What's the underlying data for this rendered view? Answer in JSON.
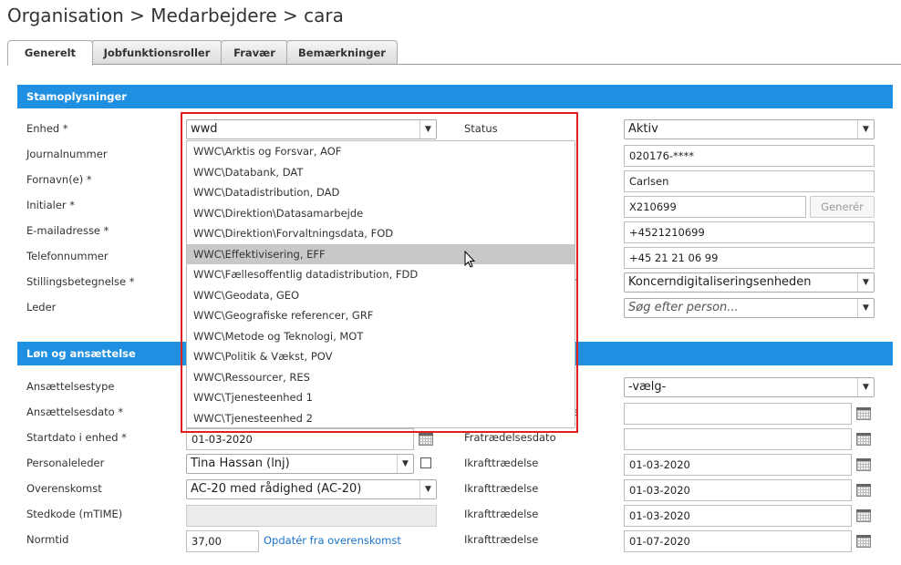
{
  "breadcrumb": {
    "part1": "Organisation",
    "sep1": ">",
    "part2": "Medarbejdere",
    "sep2": ">",
    "part3": "cara"
  },
  "tabs": [
    "Generelt",
    "Jobfunktionsroller",
    "Fravær",
    "Bemærkninger"
  ],
  "sections": {
    "stam": "Stamoplysninger",
    "loen": "Løn og ansættelse"
  },
  "left_labels": [
    "Enhed *",
    "Journalnummer",
    "Fornavn(e) *",
    "Initialer *",
    "E-mailadresse *",
    "Telefonnummer",
    "Stillingsbetegnelse *",
    "Leder"
  ],
  "enhed_input": "wwd",
  "dropdown_items": [
    "WWC\\Arktis og Forsvar, AOF",
    "WWC\\Databank, DAT",
    "WWC\\Datadistribution, DAD",
    "WWC\\Direktion\\Datasamarbejde",
    "WWC\\Direktion\\Forvaltningsdata, FOD",
    "WWC\\Effektivisering, EFF",
    "WWC\\Fællesoffentlig datadistribution, FDD",
    "WWC\\Geodata, GEO",
    "WWC\\Geografiske referencer, GRF",
    "WWC\\Metode og Teknologi, MOT",
    "WWC\\Politik & Vækst, POV",
    "WWC\\Ressourcer, RES",
    "WWC\\Tjenesteenhed 1",
    "WWC\\Tjenesteenhed 2"
  ],
  "highlighted_index": 5,
  "status_label": "Status",
  "status_value": "Aktiv",
  "right": {
    "journal": "020176-****",
    "efternavn": "Carlsen",
    "initialer": "X210699",
    "generer": "Generér",
    "email": "+4521210699",
    "telefon": "+45 21 21 06 99",
    "enhed_select": "Koncerndigitaliseringsenheden",
    "leder_placeholder": "Søg efter person..."
  },
  "loen_labels": [
    "Ansættelsestype",
    "Ansættelsesdato *",
    "Startdato i enhed *",
    "Personaleleder",
    "Overenskomst",
    "Stedkode (mTIME)",
    "Normtid"
  ],
  "loen": {
    "startdato": "01-03-2020",
    "personaleleder": "Tina Hassan (lnj)",
    "overenskomst": "AC-20 med rådighed (AC-20)",
    "stedkode": "",
    "normtid": "37,00",
    "opdater_link": "Opdatér fra overenskomst",
    "ansaettelsestype": "-vælg-",
    "fratraedelse_label": "Fratrædelsesdato",
    "ikraft_label": "Ikrafttrædelse",
    "ikraft_dates": [
      "01-03-2020",
      "01-03-2020",
      "01-03-2020",
      "01-07-2020"
    ]
  }
}
